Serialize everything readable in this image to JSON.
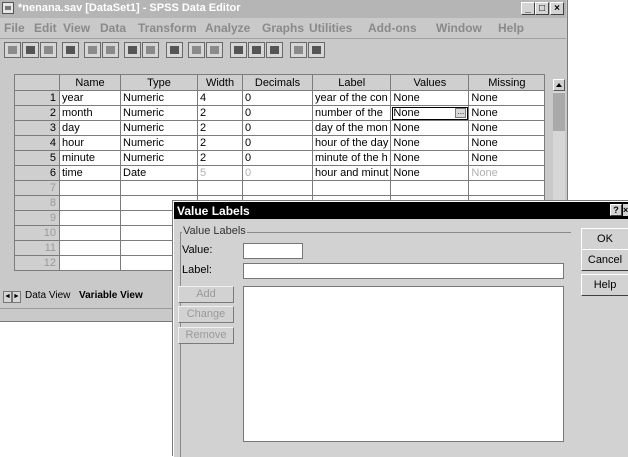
{
  "window": {
    "title": "*nenana.sav [DataSet1] - SPSS Data Editor",
    "min_label": "_",
    "max_label": "□",
    "close_label": "×"
  },
  "menu": [
    "File",
    "Edit",
    "View",
    "Data",
    "Transform",
    "Analyze",
    "Graphs",
    "Utilities",
    "Add-ons",
    "Window",
    "Help"
  ],
  "toolbar_icons": [
    "open-icon",
    "save-icon",
    "print-icon",
    "dialog-recall-icon",
    "undo-icon",
    "redo-icon",
    "goto-case-icon",
    "variables-icon",
    "find-icon",
    "insert-cases-icon",
    "insert-variable-icon",
    "split-file-icon",
    "weight-cases-icon",
    "select-cases-icon",
    "value-labels-icon",
    "use-sets-icon"
  ],
  "grid": {
    "columns": [
      "Name",
      "Type",
      "Width",
      "Decimals",
      "Label",
      "Values",
      "Missing"
    ],
    "rows": [
      {
        "num": "1",
        "name": "year",
        "type": "Numeric",
        "width": "4",
        "decimals": "0",
        "label": "year of the con",
        "values": "None",
        "missing": "None"
      },
      {
        "num": "2",
        "name": "month",
        "type": "Numeric",
        "width": "2",
        "decimals": "0",
        "label": "number of the",
        "values": "None",
        "missing": "None"
      },
      {
        "num": "3",
        "name": "day",
        "type": "Numeric",
        "width": "2",
        "decimals": "0",
        "label": "day of the mon",
        "values": "None",
        "missing": "None"
      },
      {
        "num": "4",
        "name": "hour",
        "type": "Numeric",
        "width": "2",
        "decimals": "0",
        "label": "hour of the day",
        "values": "None",
        "missing": "None"
      },
      {
        "num": "5",
        "name": "minute",
        "type": "Numeric",
        "width": "2",
        "decimals": "0",
        "label": "minute of the h",
        "values": "None",
        "missing": "None"
      },
      {
        "num": "6",
        "name": "time",
        "type": "Date",
        "width": "5",
        "decimals": "0",
        "label": "hour and minut",
        "values": "None",
        "missing": "None"
      }
    ],
    "empty_rows": [
      "7",
      "8",
      "9",
      "10",
      "11",
      "12"
    ],
    "cell_button": "..."
  },
  "tabs": {
    "data_view": "Data View",
    "variable_view": "Variable View"
  },
  "dialog": {
    "title": "Value Labels",
    "help_btn": "?",
    "close_btn": "×",
    "group_label": "Value Labels",
    "value_label": "Value:",
    "label_label": "Label:",
    "value_input": "",
    "label_input": "",
    "add": "Add",
    "change": "Change",
    "remove": "Remove",
    "ok": "OK",
    "cancel": "Cancel",
    "help": "Help"
  }
}
